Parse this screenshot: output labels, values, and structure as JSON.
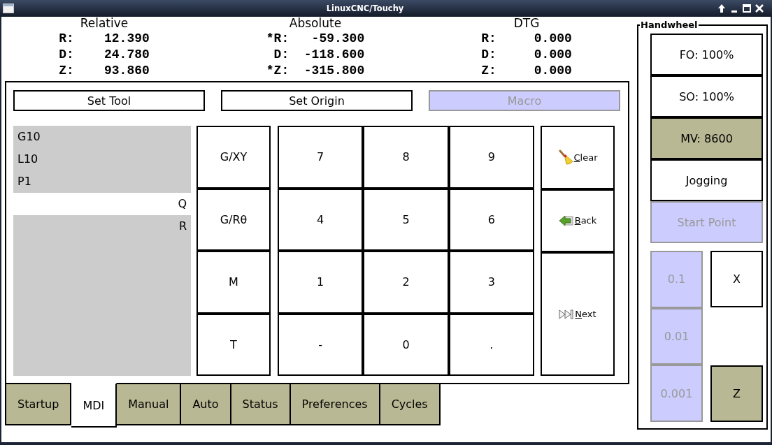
{
  "window": {
    "title": "LinuxCNC/Touchy"
  },
  "dro": [
    {
      "heading": "Relative",
      "rows": [
        {
          "axis": "R:",
          "value": "12.390"
        },
        {
          "axis": "D:",
          "value": "24.780"
        },
        {
          "axis": "Z:",
          "value": "93.860"
        }
      ]
    },
    {
      "heading": "Absolute",
      "rows": [
        {
          "axis": "*R:",
          "value": "-59.300"
        },
        {
          "axis": "D:",
          "value": "-118.600"
        },
        {
          "axis": "*Z:",
          "value": "-315.800"
        }
      ]
    },
    {
      "heading": "DTG",
      "rows": [
        {
          "axis": "R:",
          "value": "0.000"
        },
        {
          "axis": "D:",
          "value": "0.000"
        },
        {
          "axis": "Z:",
          "value": "0.000"
        }
      ]
    }
  ],
  "toolbar": [
    {
      "label": "Set Tool",
      "disabled": false
    },
    {
      "label": "Set Origin",
      "disabled": false
    },
    {
      "label": "Macro",
      "disabled": true
    }
  ],
  "mdi_words": [
    {
      "kind": "code",
      "highlighted": true,
      "lines": [
        "G10",
        "L10",
        "P1"
      ]
    },
    {
      "kind": "word",
      "highlighted": false,
      "lines": [
        "Q"
      ]
    },
    {
      "kind": "word",
      "highlighted": true,
      "lines": [
        "R"
      ]
    }
  ],
  "keypad": {
    "gcode_keys": [
      "G/XY",
      "G/Rθ",
      "M",
      "T"
    ],
    "digit_keys": [
      "7",
      "8",
      "9",
      "4",
      "5",
      "6",
      "1",
      "2",
      "3",
      "-",
      "0",
      "."
    ],
    "action_keys": [
      {
        "kind": "clear",
        "label": "Clear"
      },
      {
        "kind": "back",
        "label": "Back"
      },
      {
        "kind": "next",
        "label": "Next"
      }
    ]
  },
  "tabs": [
    {
      "label": "Startup",
      "selected": false
    },
    {
      "label": "MDI",
      "selected": true
    },
    {
      "label": "Manual",
      "selected": false
    },
    {
      "label": "Auto",
      "selected": false
    },
    {
      "label": "Status",
      "selected": false
    },
    {
      "label": "Preferences",
      "selected": false
    },
    {
      "label": "Cycles",
      "selected": false
    }
  ],
  "handwheel": {
    "title": "Handwheel",
    "modes": [
      {
        "label": "FO: 100%",
        "selected": false,
        "disabled": false
      },
      {
        "label": "SO: 100%",
        "selected": false,
        "disabled": false
      },
      {
        "label": "MV: 8600",
        "selected": true,
        "disabled": false
      },
      {
        "label": "Jogging",
        "selected": false,
        "disabled": false
      },
      {
        "label": "Start Point",
        "selected": false,
        "disabled": true
      }
    ],
    "increments": [
      {
        "label": "0.1",
        "disabled": true
      },
      {
        "label": "0.01",
        "disabled": true
      },
      {
        "label": "0.001",
        "disabled": true
      }
    ],
    "axes": [
      {
        "label": "X",
        "selected": false
      },
      {
        "label": "Z",
        "selected": true
      }
    ]
  }
}
